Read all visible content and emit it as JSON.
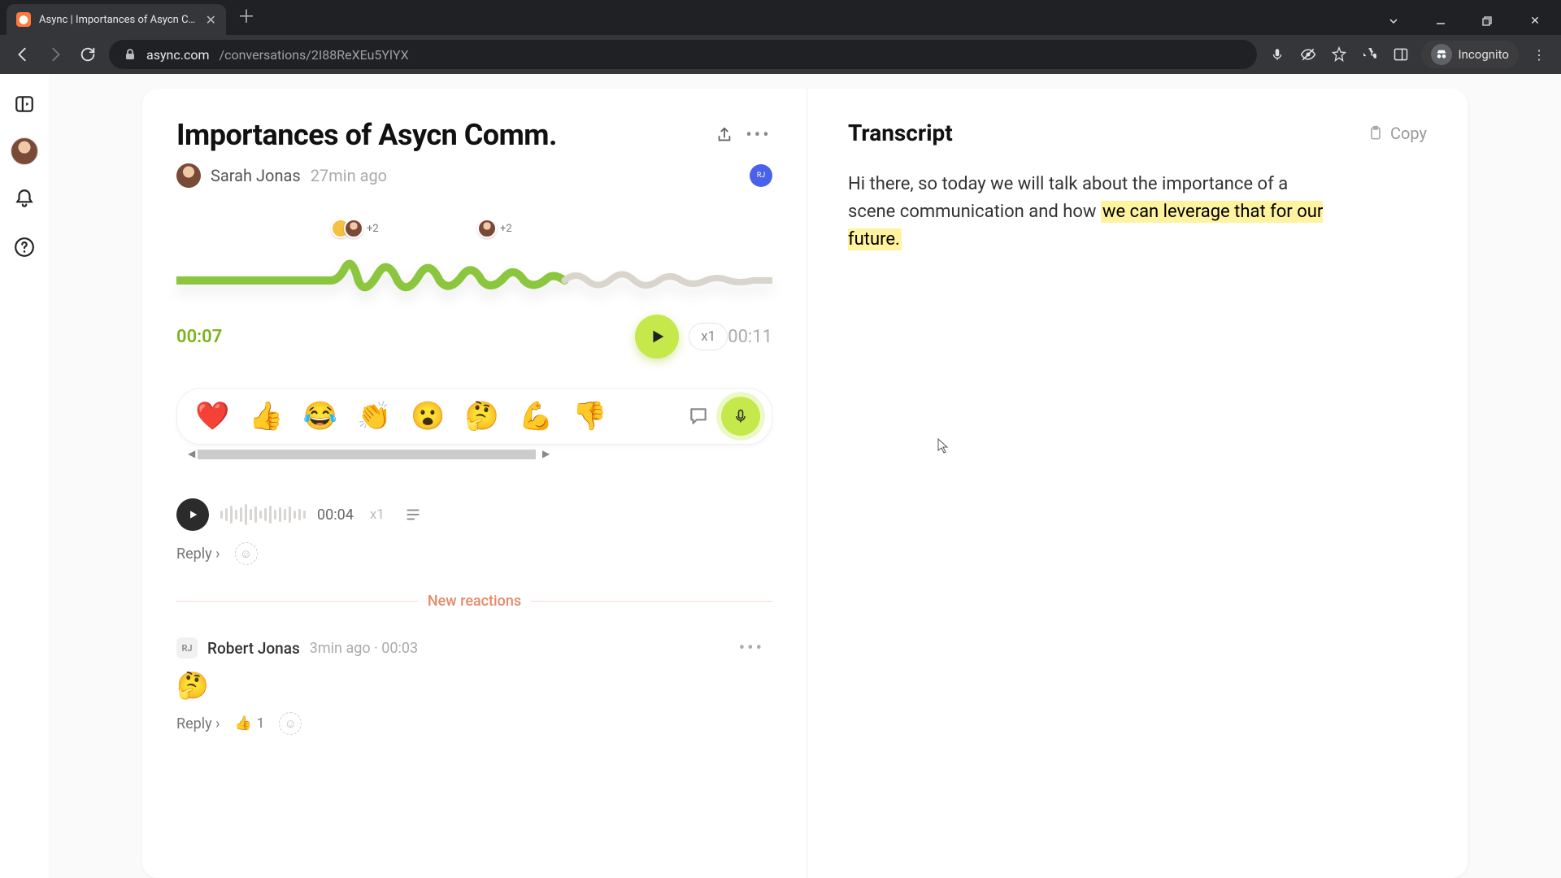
{
  "browser": {
    "tab_title": "Async | Importances of Asycn Co…",
    "url_host": "async.com",
    "url_path": "/conversations/2I88ReXEu5YlYX",
    "incognito_label": "Incognito"
  },
  "conversation": {
    "title": "Importances of Asycn Comm.",
    "author": "Sarah Jonas",
    "time_ago": "27min ago",
    "participant_badge": "RJ",
    "current_time": "00:07",
    "total_time": "00:11",
    "speed": "x1",
    "markers": [
      {
        "count": "+2"
      },
      {
        "count": "+2"
      }
    ],
    "reactions": [
      "❤️",
      "👍",
      "😂",
      "👏",
      "😮",
      "🤔",
      "💪",
      "👎"
    ]
  },
  "reply_audio": {
    "duration": "00:04",
    "speed": "x1",
    "reply_label": "Reply ›"
  },
  "new_reactions_label": "New reactions",
  "comment": {
    "badge": "RJ",
    "name": "Robert Jonas",
    "meta": "3min ago · 00:03",
    "emoji": "🤔",
    "reply_label": "Reply ›",
    "react_emoji": "👍",
    "react_count": "1"
  },
  "transcript": {
    "title": "Transcript",
    "copy_label": "Copy",
    "text_plain": "Hi there, so today we will talk about the importance of a scene communication and how ",
    "text_highlight": "we can leverage that for our future."
  }
}
